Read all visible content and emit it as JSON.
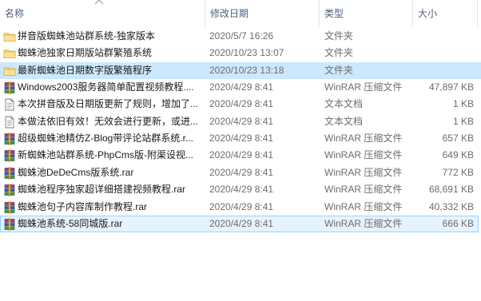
{
  "columns": {
    "name": "名称",
    "date": "修改日期",
    "type": "类型",
    "size": "大小"
  },
  "files": [
    {
      "name": "拼音版蜘蛛池站群系统-独家版本",
      "date": "2020/5/7 16:26",
      "type": "文件夹",
      "size": "",
      "icon": "folder-icon"
    },
    {
      "name": "蜘蛛池独家日期版站群繁殖系统",
      "date": "2020/10/23 13:07",
      "type": "文件夹",
      "size": "",
      "icon": "folder-icon"
    },
    {
      "name": "最新蜘蛛池日期数字版繁殖程序",
      "date": "2020/10/23 13:18",
      "type": "文件夹",
      "size": "",
      "icon": "folder-icon"
    },
    {
      "name": "Windows2003服务器简单配置视频教程....",
      "date": "2020/4/29 8:41",
      "type": "WinRAR 压缩文件",
      "size": "47,897 KB",
      "icon": "rar-icon"
    },
    {
      "name": "本次拼音版及日期版更新了规则，增加了...",
      "date": "2020/4/29 8:41",
      "type": "文本文档",
      "size": "1 KB",
      "icon": "text-document-icon"
    },
    {
      "name": "本做法依旧有效！无效会进行更新，或进...",
      "date": "2020/4/29 8:41",
      "type": "文本文档",
      "size": "1 KB",
      "icon": "text-document-icon"
    },
    {
      "name": "超级蜘蛛池精仿Z-Blog带评论站群系统.r...",
      "date": "2020/4/29 8:41",
      "type": "WinRAR 压缩文件",
      "size": "657 KB",
      "icon": "rar-icon"
    },
    {
      "name": "新蜘蛛池站群系统-PhpCms版-附渠设视...",
      "date": "2020/4/29 8:41",
      "type": "WinRAR 压缩文件",
      "size": "649 KB",
      "icon": "rar-icon"
    },
    {
      "name": "蜘蛛池DeDeCms版系统.rar",
      "date": "2020/4/29 8:41",
      "type": "WinRAR 压缩文件",
      "size": "772 KB",
      "icon": "rar-icon"
    },
    {
      "name": "蜘蛛池程序独家超详细搭建视频教程.rar",
      "date": "2020/4/29 8:41",
      "type": "WinRAR 压缩文件",
      "size": "68,691 KB",
      "icon": "rar-icon"
    },
    {
      "name": "蜘蛛池句子内容库制作教程.rar",
      "date": "2020/4/29 8:41",
      "type": "WinRAR 压缩文件",
      "size": "40,332 KB",
      "icon": "rar-icon"
    },
    {
      "name": "蜘蛛池系统-58同城版.rar",
      "date": "2020/4/29 8:41",
      "type": "WinRAR 压缩文件",
      "size": "666 KB",
      "icon": "rar-icon"
    }
  ],
  "selected_index": 2,
  "outlined_index": 11,
  "colors": {
    "header_text": "#4c607a",
    "selection": "#cce8ff",
    "folder": "#f8d775",
    "secondary_text": "#6d6d6d"
  }
}
